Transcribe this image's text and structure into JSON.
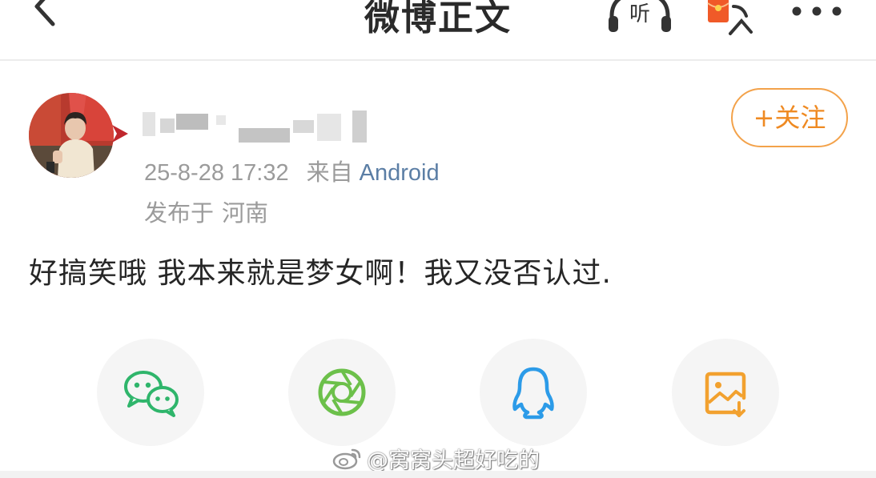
{
  "navbar": {
    "title": "微博正文",
    "back_icon": "chevron-left-icon",
    "listen_label": "听",
    "listen_icon": "headphones-icon",
    "redpacket_icon": "red-envelope-icon",
    "more_icon": "more-dots-icon"
  },
  "post": {
    "author_name_blurred": true,
    "timestamp": "25-8-28 17:32",
    "source_prefix": "来自",
    "source": "Android",
    "location_prefix": "发布于",
    "location": "河南",
    "follow_label": "+关注",
    "text": "好搞笑哦  我本来就是梦女啊！我又没否认过."
  },
  "share": [
    {
      "name": "wechat",
      "icon": "wechat-icon",
      "color": "#2fb56b"
    },
    {
      "name": "moments",
      "icon": "moments-icon",
      "color": "#6cc04a"
    },
    {
      "name": "qq",
      "icon": "qq-icon",
      "color": "#2c9be8"
    },
    {
      "name": "save-image",
      "icon": "save-image-icon",
      "color": "#f2a12f"
    }
  ],
  "watermark": {
    "text": "@窝窝头超好吃的",
    "logo_icon": "weibo-logo-icon"
  },
  "colors": {
    "accent_orange": "#ef8a22",
    "link_blue": "#5b7ea5",
    "meta_gray": "#9b9b9b"
  }
}
